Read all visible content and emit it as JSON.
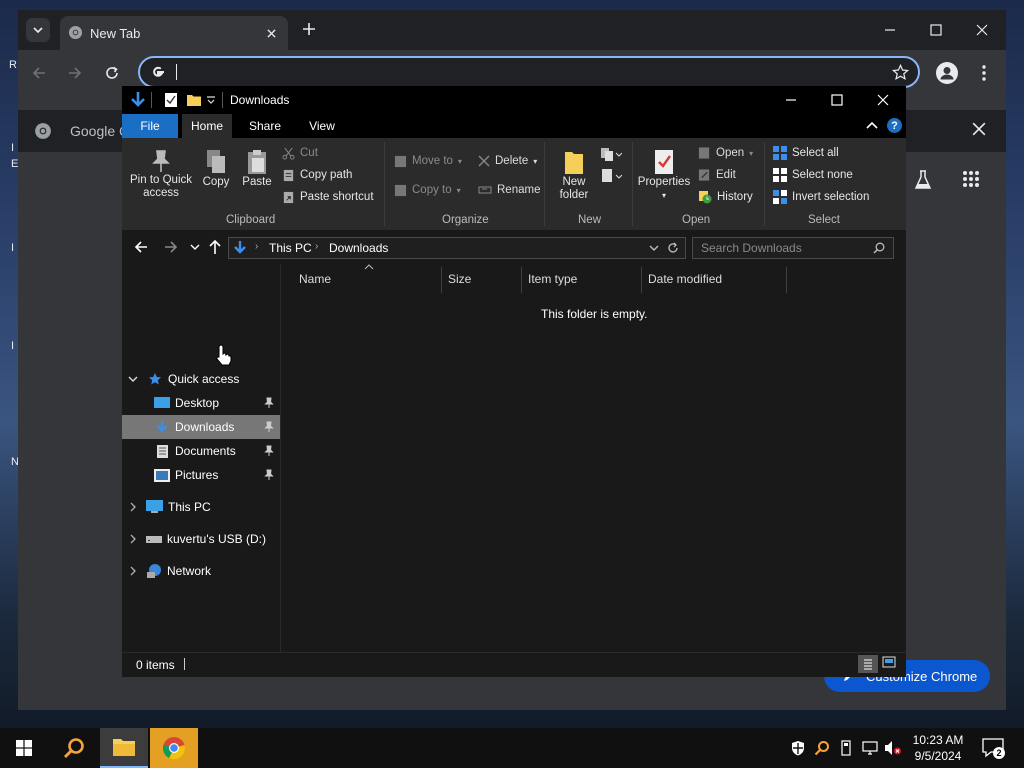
{
  "desktop": {
    "edge_chars": [
      "R",
      "I",
      "E",
      "I",
      "I",
      "N"
    ]
  },
  "chrome": {
    "tab_title": "New Tab",
    "google_bar_text": "Google C",
    "customize_label": "Customize Chrome",
    "accent": "#8ab4f8"
  },
  "explorer": {
    "title": "Downloads",
    "ribbon_tabs": [
      "File",
      "Home",
      "Share",
      "View"
    ],
    "clipboard": {
      "pin": "Pin to Quick access",
      "copy": "Copy",
      "paste": "Paste",
      "cut": "Cut",
      "copy_path": "Copy path",
      "paste_shortcut": "Paste shortcut",
      "label": "Clipboard"
    },
    "organize": {
      "move_to": "Move to",
      "copy_to": "Copy to",
      "delete": "Delete",
      "rename": "Rename",
      "label": "Organize"
    },
    "new": {
      "new_folder": "New folder",
      "label": "New"
    },
    "open": {
      "properties": "Properties",
      "open": "Open",
      "edit": "Edit",
      "history": "History",
      "label": "Open"
    },
    "select": {
      "select_all": "Select all",
      "select_none": "Select none",
      "invert": "Invert selection",
      "label": "Select"
    },
    "breadcrumb": [
      "This PC",
      "Downloads"
    ],
    "search_placeholder": "Search Downloads",
    "nav": {
      "quick_access": "Quick access",
      "desktop": "Desktop",
      "downloads": "Downloads",
      "documents": "Documents",
      "pictures": "Pictures",
      "this_pc": "This PC",
      "usb": "kuvertu's USB (D:)",
      "network": "Network"
    },
    "columns": [
      "Name",
      "Size",
      "Item type",
      "Date modified"
    ],
    "empty_message": "This folder is empty.",
    "status": "0 items",
    "file_tab_color": "#1a6fc4"
  },
  "taskbar": {
    "time": "10:23 AM",
    "date": "9/5/2024",
    "notifications": "2"
  }
}
